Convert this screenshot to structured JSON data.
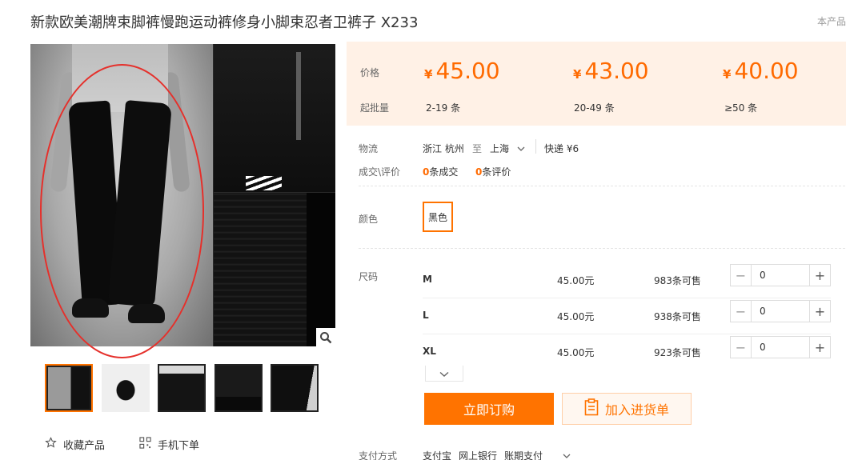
{
  "product": {
    "title": "新款欧美潮牌束脚裤慢跑运动裤修身小脚束忍者卫裤子 X233",
    "corner_link": "本产品"
  },
  "gallery": {
    "zoom_icon": "magnifier-icon",
    "thumbnail_count": 5
  },
  "actions": {
    "favorite_label": "收藏产品",
    "favorite_icon": "star-outline-icon",
    "mobile_label": "手机下单",
    "mobile_icon": "qr-code-icon"
  },
  "pricing": {
    "price_label": "价格",
    "moq_label": "起批量",
    "currency_symbol": "¥",
    "tiers": [
      {
        "price": "45.00",
        "range": "2-19",
        "unit": "条"
      },
      {
        "price": "43.00",
        "range": "20-49",
        "unit": "条"
      },
      {
        "price": "40.00",
        "range": "≥50",
        "unit": "条"
      }
    ],
    "accent_color": "#ff6a00",
    "background_color": "#fff1e6"
  },
  "logistics": {
    "label": "物流",
    "origin_province": "浙江",
    "origin_city": "杭州",
    "to_word": "至",
    "destination": "上海",
    "method": "快递",
    "fee": "¥6"
  },
  "reviews": {
    "label": "成交\\评价",
    "deals_count": "0",
    "deals_text": "条成交",
    "reviews_count": "0",
    "reviews_text": "条评价"
  },
  "color": {
    "label": "颜色",
    "selected": "黑色"
  },
  "sizes": {
    "label": "尺码",
    "rows": [
      {
        "size": "M",
        "price": "45.00元",
        "stock": "983条可售",
        "qty": "0"
      },
      {
        "size": "L",
        "price": "45.00元",
        "stock": "938条可售",
        "qty": "0"
      },
      {
        "size": "XL",
        "price": "45.00元",
        "stock": "923条可售",
        "qty": "0"
      }
    ]
  },
  "buttons": {
    "buy_now": "立即订购",
    "add_to_list": "加入进货单",
    "primary_color": "#ff7300"
  },
  "payment": {
    "label": "支付方式",
    "options": [
      "支付宝",
      "网上银行",
      "账期支付"
    ]
  }
}
